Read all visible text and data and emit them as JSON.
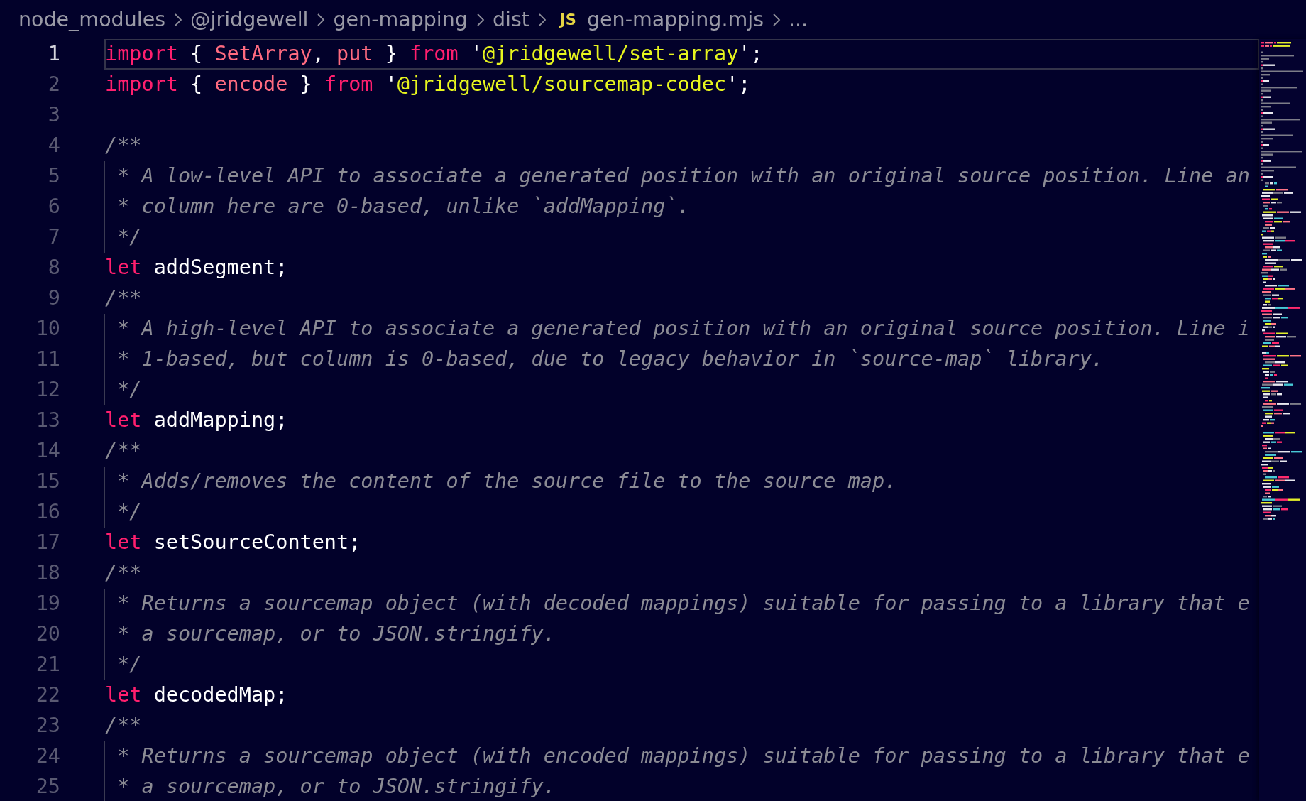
{
  "breadcrumb": {
    "items": [
      {
        "label": "node_modules"
      },
      {
        "label": "@jridgewell"
      },
      {
        "label": "gen-mapping"
      },
      {
        "label": "dist"
      },
      {
        "label": "gen-mapping.mjs",
        "icon_text": "JS"
      },
      {
        "label": "..."
      }
    ]
  },
  "editor": {
    "lines": [
      {
        "number": "1",
        "selected": true,
        "tokens": [
          {
            "kind": "keyword",
            "text": "import"
          },
          {
            "kind": "plain",
            "text": " { "
          },
          {
            "kind": "name",
            "text": "SetArray"
          },
          {
            "kind": "plain",
            "text": ", "
          },
          {
            "kind": "name",
            "text": "put"
          },
          {
            "kind": "plain",
            "text": " } "
          },
          {
            "kind": "keyword",
            "text": "from"
          },
          {
            "kind": "plain",
            "text": " '"
          },
          {
            "kind": "string",
            "text": "@jridgewell/set-array"
          },
          {
            "kind": "plain",
            "text": "';"
          }
        ]
      },
      {
        "number": "2",
        "selected": false,
        "tokens": [
          {
            "kind": "keyword",
            "text": "import"
          },
          {
            "kind": "plain",
            "text": " { "
          },
          {
            "kind": "name",
            "text": "encode"
          },
          {
            "kind": "plain",
            "text": " } "
          },
          {
            "kind": "keyword",
            "text": "from"
          },
          {
            "kind": "plain",
            "text": " '"
          },
          {
            "kind": "string",
            "text": "@jridgewell/sourcemap-codec"
          },
          {
            "kind": "plain",
            "text": "';"
          }
        ]
      },
      {
        "number": "3",
        "selected": false
      },
      {
        "number": "4",
        "selected": false,
        "tokens": [
          {
            "kind": "comment",
            "text": "/**"
          }
        ],
        "children": [
          {
            "number": "5",
            "selected": false,
            "tokens": [
              {
                "kind": "comment",
                "text": " * A low-level API to associate a generated position with an original source position. Line an"
              }
            ]
          },
          {
            "number": "6",
            "selected": false,
            "tokens": [
              {
                "kind": "comment",
                "text": " * column here are 0-based, unlike `addMapping`."
              }
            ]
          },
          {
            "number": "7",
            "selected": false,
            "tokens": [
              {
                "kind": "comment",
                "text": " */"
              }
            ]
          }
        ]
      },
      {
        "number": "8",
        "selected": false,
        "tokens": [
          {
            "kind": "keyword",
            "text": "let"
          },
          {
            "kind": "identifier",
            "text": " addSegment;"
          }
        ]
      },
      {
        "number": "9",
        "selected": false,
        "tokens": [
          {
            "kind": "comment",
            "text": "/**"
          }
        ],
        "children": [
          {
            "number": "10",
            "selected": false,
            "tokens": [
              {
                "kind": "comment",
                "text": " * A high-level API to associate a generated position with an original source position. Line i"
              }
            ]
          },
          {
            "number": "11",
            "selected": false,
            "tokens": [
              {
                "kind": "comment",
                "text": " * 1-based, but column is 0-based, due to legacy behavior in `source-map` library."
              }
            ]
          },
          {
            "number": "12",
            "selected": false,
            "tokens": [
              {
                "kind": "comment",
                "text": " */"
              }
            ]
          }
        ]
      },
      {
        "number": "13",
        "selected": false,
        "tokens": [
          {
            "kind": "keyword",
            "text": "let"
          },
          {
            "kind": "identifier",
            "text": " addMapping;"
          }
        ]
      },
      {
        "number": "14",
        "selected": false,
        "tokens": [
          {
            "kind": "comment",
            "text": "/**"
          }
        ],
        "children": [
          {
            "number": "15",
            "selected": false,
            "tokens": [
              {
                "kind": "comment",
                "text": " * Adds/removes the content of the source file to the source map."
              }
            ]
          },
          {
            "number": "16",
            "selected": false,
            "tokens": [
              {
                "kind": "comment",
                "text": " */"
              }
            ]
          }
        ]
      },
      {
        "number": "17",
        "selected": false,
        "tokens": [
          {
            "kind": "keyword",
            "text": "let"
          },
          {
            "kind": "identifier",
            "text": " setSourceContent;"
          }
        ]
      },
      {
        "number": "18",
        "selected": false,
        "tokens": [
          {
            "kind": "comment",
            "text": "/**"
          }
        ],
        "children": [
          {
            "number": "19",
            "selected": false,
            "tokens": [
              {
                "kind": "comment",
                "text": " * Returns a sourcemap object (with decoded mappings) suitable for passing to a library that e"
              }
            ]
          },
          {
            "number": "20",
            "selected": false,
            "tokens": [
              {
                "kind": "comment",
                "text": " * a sourcemap, or to JSON.stringify."
              }
            ]
          },
          {
            "number": "21",
            "selected": false,
            "tokens": [
              {
                "kind": "comment",
                "text": " */"
              }
            ]
          }
        ]
      },
      {
        "number": "22",
        "selected": false,
        "tokens": [
          {
            "kind": "keyword",
            "text": "let"
          },
          {
            "kind": "identifier",
            "text": " decodedMap;"
          }
        ]
      },
      {
        "number": "23",
        "selected": false,
        "tokens": [
          {
            "kind": "comment",
            "text": "/**"
          }
        ],
        "children": [
          {
            "number": "24",
            "selected": false,
            "tokens": [
              {
                "kind": "comment",
                "text": " * Returns a sourcemap object (with encoded mappings) suitable for passing to a library that e"
              }
            ]
          },
          {
            "number": "25",
            "selected": false,
            "tokens": [
              {
                "kind": "comment",
                "text": " * a sourcemap, or to JSON.stringify."
              }
            ]
          }
        ]
      }
    ]
  }
}
